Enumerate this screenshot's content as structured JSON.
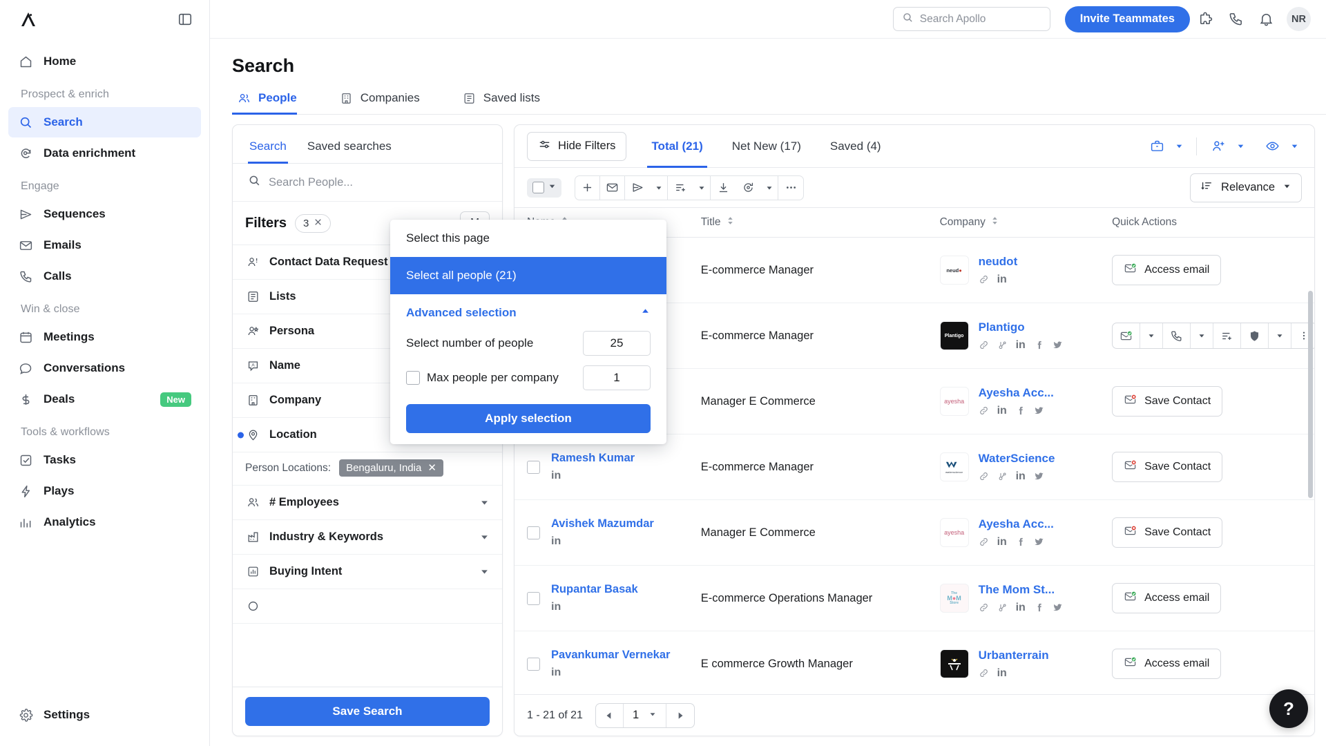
{
  "app": {
    "name": "Apollo",
    "logo_icon": "apollo-logo-icon"
  },
  "sidebar": {
    "collapse_icon": "panel-collapse-icon",
    "items": [
      {
        "label": "Home",
        "icon": "home-icon",
        "type": "item"
      },
      {
        "label": "Prospect & enrich",
        "type": "group"
      },
      {
        "label": "Search",
        "icon": "search-icon",
        "type": "item",
        "active": true
      },
      {
        "label": "Data enrichment",
        "icon": "data-enrichment-icon",
        "type": "item"
      },
      {
        "label": "Engage",
        "type": "group"
      },
      {
        "label": "Sequences",
        "icon": "send-icon",
        "type": "item"
      },
      {
        "label": "Emails",
        "icon": "envelope-icon",
        "type": "item"
      },
      {
        "label": "Calls",
        "icon": "phone-icon",
        "type": "item"
      },
      {
        "label": "Win & close",
        "type": "group"
      },
      {
        "label": "Meetings",
        "icon": "calendar-icon",
        "type": "item"
      },
      {
        "label": "Conversations",
        "icon": "chat-bubble-icon",
        "type": "item"
      },
      {
        "label": "Deals",
        "icon": "dollar-icon",
        "type": "item",
        "badge": "New"
      },
      {
        "label": "Tools & workflows",
        "type": "group"
      },
      {
        "label": "Tasks",
        "icon": "checkbox-task-icon",
        "type": "item"
      },
      {
        "label": "Plays",
        "icon": "lightning-icon",
        "type": "item"
      },
      {
        "label": "Analytics",
        "icon": "bar-chart-icon",
        "type": "item"
      }
    ],
    "settings": {
      "label": "Settings",
      "icon": "gear-icon"
    }
  },
  "topbar": {
    "search_placeholder": "Search Apollo",
    "search_icon": "search-icon",
    "invite_label": "Invite Teammates",
    "icons": [
      "puzzle-piece-icon",
      "phone-icon",
      "bell-icon"
    ],
    "avatar_initials": "NR"
  },
  "page": {
    "title": "Search",
    "tabs": [
      {
        "label": "People",
        "icon": "people-icon",
        "active": true
      },
      {
        "label": "Companies",
        "icon": "building-icon",
        "active": false
      },
      {
        "label": "Saved lists",
        "icon": "list-icon",
        "active": false
      }
    ]
  },
  "filter_panel": {
    "tabs": [
      {
        "label": "Search",
        "active": true
      },
      {
        "label": "Saved searches",
        "active": false
      }
    ],
    "search_placeholder": "Search People...",
    "search_icon": "search-icon",
    "filters_label": "Filters",
    "filters_count": "3",
    "clear_icon": "close-icon",
    "more_label": "M",
    "rows": [
      {
        "label": "Contact Data Request",
        "icon": "contact-request-icon",
        "caret": false
      },
      {
        "label": "Lists",
        "icon": "list-icon",
        "caret": false
      },
      {
        "label": "Persona",
        "icon": "persona-icon",
        "caret": false
      },
      {
        "label": "Name",
        "icon": "name-tag-icon",
        "caret": false
      },
      {
        "label": "Company",
        "icon": "building-icon",
        "caret": true
      },
      {
        "label": "Location",
        "icon": "map-pin-icon",
        "caret": true,
        "active": true,
        "pill": "1"
      },
      {
        "label": "# Employees",
        "icon": "employees-icon",
        "caret": true
      },
      {
        "label": "Industry & Keywords",
        "icon": "industry-icon",
        "caret": true
      },
      {
        "label": "Buying Intent",
        "icon": "bar-chart-icon",
        "caret": true
      }
    ],
    "location_sub": {
      "label": "Person Locations:",
      "tag": "Bengaluru, India",
      "tag_remove_icon": "close-icon"
    },
    "save_search_label": "Save Search"
  },
  "results": {
    "hide_filters_label": "Hide Filters",
    "hide_filters_icon": "filter-sliders-icon",
    "tabs": [
      {
        "label": "Total (21)",
        "active": true
      },
      {
        "label": "Net New (17)",
        "active": false
      },
      {
        "label": "Saved (4)",
        "active": false
      }
    ],
    "header_actions": [
      {
        "icon": "briefcase-icon",
        "caret": true
      },
      {
        "icon": "add-person-icon",
        "caret": true
      },
      {
        "icon": "eye-icon",
        "caret": true
      }
    ],
    "toolbar_icons": [
      "plus-icon",
      "envelope-icon",
      "send-icon",
      "caret-down-icon",
      "add-to-list-icon",
      "caret-down-icon",
      "download-icon",
      "refresh-icon",
      "caret-down-icon",
      "more-horizontal-icon"
    ],
    "sort_label": "Relevance",
    "sort_icon": "sort-icon",
    "columns": [
      "Name",
      "Title",
      "Company",
      "Quick Actions"
    ],
    "rows": [
      {
        "name": "",
        "title": "E-commerce Manager",
        "company": "neudot",
        "company_logo_text": "neudot",
        "company_socials": [
          "link-icon",
          "linkedin-icon"
        ],
        "action": "Access email",
        "action_icon": "email-verified-icon",
        "action_state": "verified"
      },
      {
        "name": "",
        "title": "E-commerce Manager",
        "company": "Plantigo",
        "company_logo_text": "Plantigo",
        "company_socials": [
          "link-icon",
          "hubspot-icon",
          "linkedin-icon",
          "facebook-icon",
          "twitter-icon"
        ],
        "action": "",
        "action_icon": "email-verified-icon",
        "action_state": "group"
      },
      {
        "name": "",
        "title": "Manager E Commerce",
        "company": "Ayesha Acc...",
        "company_logo_text": "ayesha",
        "company_socials": [
          "link-icon",
          "linkedin-icon",
          "facebook-icon",
          "twitter-icon"
        ],
        "action": "Save Contact",
        "action_icon": "email-unverified-icon",
        "action_state": "unverified"
      },
      {
        "name": "Ramesh Kumar",
        "title": "E-commerce Manager",
        "company": "WaterScience",
        "company_logo_text": "waterscience",
        "company_socials": [
          "link-icon",
          "hubspot-icon",
          "linkedin-icon",
          "twitter-icon"
        ],
        "action": "Save Contact",
        "action_icon": "email-unverified-icon",
        "action_state": "unverified"
      },
      {
        "name": "Avishek Mazumdar",
        "title": "Manager E Commerce",
        "company": "Ayesha Acc...",
        "company_logo_text": "ayesha",
        "company_socials": [
          "link-icon",
          "linkedin-icon",
          "facebook-icon",
          "twitter-icon"
        ],
        "action": "Save Contact",
        "action_icon": "email-unverified-icon",
        "action_state": "unverified"
      },
      {
        "name": "Rupantar Basak",
        "title": "E-commerce Operations Manager",
        "company": "The Mom St...",
        "company_logo_text": "The MOM Store",
        "company_socials": [
          "link-icon",
          "hubspot-icon",
          "linkedin-icon",
          "facebook-icon",
          "twitter-icon"
        ],
        "action": "Access email",
        "action_icon": "email-verified-icon",
        "action_state": "verified"
      },
      {
        "name": "Pavankumar Vernekar",
        "title": "E commerce Growth Manager",
        "company": "Urbanterrain",
        "company_logo_text": "Urbanterrain",
        "company_socials": [
          "link-icon",
          "linkedin-icon"
        ],
        "action": "Access email",
        "action_icon": "email-verified-icon",
        "action_state": "verified"
      }
    ],
    "pagination": {
      "info": "1 - 21 of 21",
      "page": "1",
      "prev_icon": "caret-left-icon",
      "next_icon": "caret-right-icon"
    }
  },
  "selection_dropdown": {
    "select_page_label": "Select this page",
    "select_all_label": "Select all people (21)",
    "advanced_label": "Advanced selection",
    "collapse_icon": "caret-up-icon",
    "number_label": "Select number of people",
    "number_value": "25",
    "max_label": "Max people per company",
    "max_value": "1",
    "apply_label": "Apply selection"
  },
  "help_fab": {
    "label": "?",
    "icon": "help-icon"
  },
  "colors": {
    "accent": "#3070e8",
    "accent_light": "#eaf0fe",
    "green": "#46c97f",
    "text": "#1c1e21",
    "muted": "#8b9099",
    "border": "#e3e5e9"
  }
}
